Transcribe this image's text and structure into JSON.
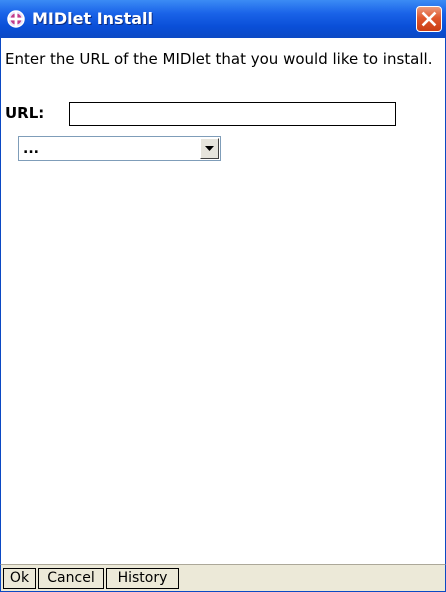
{
  "window": {
    "title": "MIDlet Install",
    "icon": "midlet-app-icon",
    "close_icon": "close-icon",
    "titlebar_color": "#0a4fd8",
    "close_color": "#e0582e"
  },
  "form": {
    "prompt": "Enter the URL of the MIDlet that you would like to install.",
    "url_label": "URL:",
    "url_value": "",
    "history_selected": "..."
  },
  "commands": {
    "ok": "Ok",
    "cancel": "Cancel",
    "history": "History"
  }
}
